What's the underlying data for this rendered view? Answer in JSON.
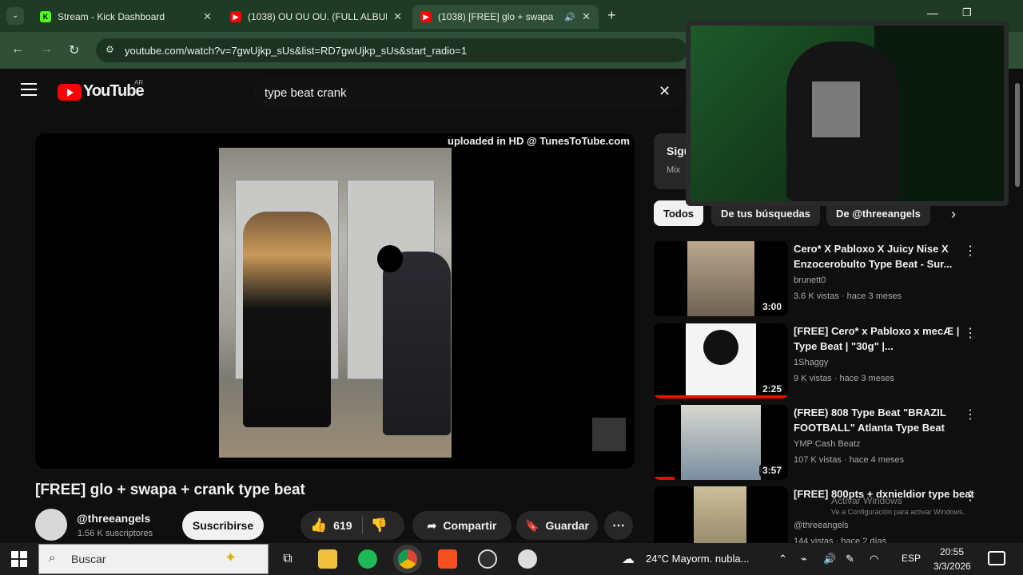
{
  "browser": {
    "tabs": [
      {
        "label": "Stream - Kick Dashboard",
        "icon": "kick-icon",
        "active": false
      },
      {
        "label": "(1038) OU OU OU. (FULL ALBUM",
        "icon": "youtube-icon",
        "active": false
      },
      {
        "label": "(1038) [FREE] glo + swapa",
        "icon": "youtube-icon",
        "active": true
      }
    ],
    "url": "youtube.com/watch?v=7gwUjkp_sUs&list=RD7gwUjkp_sUs&start_radio=1"
  },
  "youtube": {
    "logo_text": "YouTube",
    "logo_badge": "AR",
    "search_value": "type beat crank",
    "overlay_text": "uploaded in HD @ TunesToTube.com",
    "video_title": "[FREE] glo + swapa + crank type beat",
    "channel_name": "@threeangels",
    "subscribers": "1.56 K suscriptores",
    "subscribe_label": "Suscribirse",
    "like_count": "619",
    "share_label": "Compartir",
    "save_label": "Guardar",
    "next_up_label": "Sigu",
    "next_up_sub": "Mix",
    "chips": [
      "Todos",
      "De tus búsquedas",
      "De @threeangels"
    ],
    "recommendations": [
      {
        "title": "Cero* X Pabloxo X Juicy Nise X Enzocerobulto Type Beat - Sur...",
        "channel": "brunett0",
        "meta": "3.6 K vistas · hace 3 meses",
        "duration": "3:00",
        "progress": 0
      },
      {
        "title": "[FREE] Cero* x Pabloxo x mecÆ | Type Beat | \"30g\" |...",
        "channel": "1Shaggy",
        "meta": "9 K vistas · hace 3 meses",
        "duration": "2:25",
        "progress": 1.0
      },
      {
        "title": "(FREE) 808 Type Beat \"BRAZIL FOOTBALL\" Atlanta Type Beat",
        "channel": "YMP Cash Beatz",
        "meta": "107 K vistas · hace 4 meses",
        "duration": "3:57",
        "progress": 0.15
      },
      {
        "title": "[FREE] 800pts + dxnieldior type beat",
        "channel": "@threeangels",
        "meta": "144 vistas · hace 2 días",
        "duration": "",
        "progress": 0
      }
    ],
    "activate_windows": "Activar Windows",
    "activate_windows_sub": "Ve a Configuración para activar Windows."
  },
  "taskbar": {
    "search_placeholder": "Buscar",
    "weather": "24°C  Mayorm. nubla...",
    "lang": "ESP",
    "time": "20:55",
    "date": "3/3/2026"
  }
}
